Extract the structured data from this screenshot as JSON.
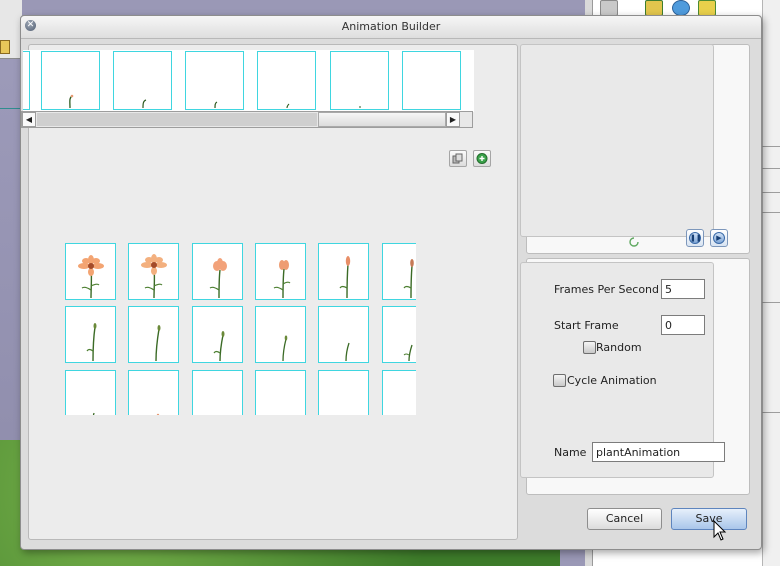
{
  "window": {
    "title": "Animation Builder"
  },
  "timeline": {
    "frame_count": 6
  },
  "frames_grid": {
    "rows": 3,
    "cols": 6
  },
  "preview": {},
  "settings": {
    "fps_label": "Frames Per Second",
    "fps_value": "5",
    "start_frame_label": "Start Frame",
    "start_frame_value": "0",
    "random_label": "Random",
    "random_checked": false,
    "cycle_label": "Cycle Animation",
    "cycle_checked": false,
    "name_label": "Name",
    "name_value": "plantAnimation"
  },
  "buttons": {
    "cancel_label": "Cancel",
    "save_label": "Save"
  },
  "colors": {
    "frame_border": "#3fd6e0",
    "save_button": "#a9c6ea",
    "petal": "#f3a472"
  },
  "icons": [
    "close-icon",
    "copy-icon",
    "add-icon",
    "pause-icon",
    "play-icon",
    "loading-spinner-icon",
    "scroll-left-arrow-icon",
    "scroll-right-arrow-icon",
    "mouse-cursor-icon"
  ]
}
